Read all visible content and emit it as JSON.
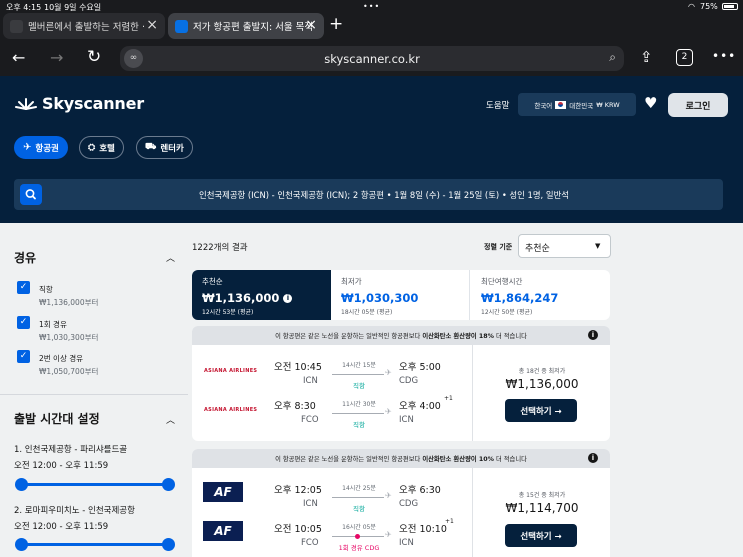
{
  "status": {
    "time": "오후 4:15",
    "date": "10월 9일 수요일",
    "battery": "75%"
  },
  "browser": {
    "tabs": [
      {
        "title": "멜버른에서 출발하는 저렴한 ·"
      },
      {
        "title": "저가 항공편 출발지: 서울 목적"
      }
    ],
    "url": "skyscanner.co.kr",
    "tab_count": "2"
  },
  "header": {
    "logo": "Skyscanner",
    "help": "도움말",
    "locale": {
      "lang": "한국어",
      "region": "대한민국",
      "currency": "₩ KRW"
    },
    "login": "로그인",
    "nav": [
      {
        "label": "항공권"
      },
      {
        "label": "호텔"
      },
      {
        "label": "렌터카"
      }
    ],
    "search_summary": "인천국제공항 (ICN) - 인천국제공항 (ICN); 2 항공편 • 1월 8일 (수) - 1월 25일 (토) • 성인 1명, 일반석"
  },
  "sidebar": {
    "stops_title": "경유",
    "stops": [
      {
        "label": "직항",
        "price": "₩1,136,000부터"
      },
      {
        "label": "1회 경유",
        "price": "₩1,030,300부터"
      },
      {
        "label": "2번 이상 경유",
        "price": "₩1,050,700부터"
      }
    ],
    "time_title": "출발 시간대 설정",
    "routes": [
      {
        "name": "1. 인천국제공항 - 파리샤를드골",
        "time": "오전 12:00 - 오후 11:59"
      },
      {
        "name": "2. 로마피우미치노 - 인천국제공항",
        "time": "오전 12:00 - 오후 11:59"
      }
    ]
  },
  "results": {
    "count": "1222개의 결과",
    "sort_label": "정렬 기준",
    "sort_value": "추천순",
    "sort_tabs": [
      {
        "label": "추천순",
        "price": "₩1,136,000",
        "sub": "12시간 53분 (평균)"
      },
      {
        "label": "최저가",
        "price": "₩1,030,300",
        "sub": "18시간 05분 (평균)"
      },
      {
        "label": "최단여행시간",
        "price": "₩1,864,247",
        "sub": "12시간 50분 (평균)"
      }
    ],
    "cards": [
      {
        "banner_pre": "이 항공편은 같은 노선을 운항하는 일반적인 항공편보다",
        "banner_bold": "이산화탄소 환산량이 18%",
        "banner_post": "더 적습니다",
        "legs": [
          {
            "airline": "ASIANA AIRLINES",
            "dep_time": "오전 10:45",
            "dep": "ICN",
            "duration": "14시간 15분",
            "stops": "직항",
            "arr_time": "오후 5:00",
            "arr": "CDG",
            "plus": ""
          },
          {
            "airline": "ASIANA AIRLINES",
            "dep_time": "오후 8:30",
            "dep": "FCO",
            "duration": "11시간 30분",
            "stops": "직항",
            "arr_time": "오후 4:00",
            "arr": "ICN",
            "plus": "+1"
          }
        ],
        "deals": "총 18건 중 최저가",
        "price": "₩1,136,000",
        "select": "선택하기 →"
      },
      {
        "banner_pre": "이 항공편은 같은 노선을 운항하는 일반적인 항공편보다",
        "banner_bold": "이산화탄소 환산량이 10%",
        "banner_post": "더 적습니다",
        "legs": [
          {
            "airline": "AF",
            "dep_time": "오후 12:05",
            "dep": "ICN",
            "duration": "14시간 25분",
            "stops": "직항",
            "arr_time": "오후 6:30",
            "arr": "CDG",
            "plus": ""
          },
          {
            "airline": "AF",
            "dep_time": "오전 10:05",
            "dep": "FCO",
            "duration": "16시간 05분",
            "stops": "1회 경유 CDG",
            "arr_time": "오전 10:10",
            "arr": "ICN",
            "plus": "+1"
          }
        ],
        "deals": "총 15건 중 최저가",
        "price": "₩1,114,700",
        "select": "선택하기 →"
      }
    ]
  }
}
